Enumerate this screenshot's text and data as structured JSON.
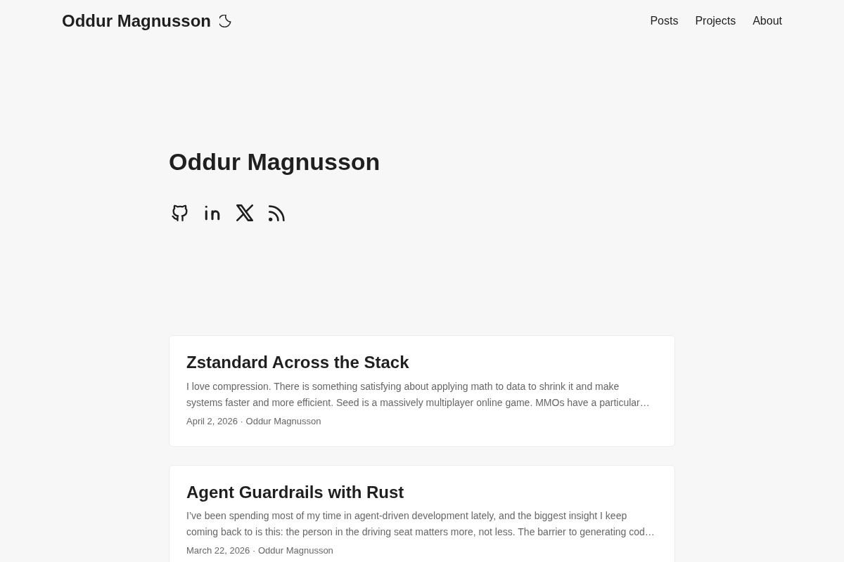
{
  "header": {
    "site_title": "Oddur Magnusson",
    "nav": [
      {
        "label": "Posts"
      },
      {
        "label": "Projects"
      },
      {
        "label": "About"
      }
    ]
  },
  "hero": {
    "title": "Oddur Magnusson",
    "social_links": [
      {
        "kind": "github"
      },
      {
        "kind": "linkedin"
      },
      {
        "kind": "x"
      },
      {
        "kind": "rss"
      }
    ]
  },
  "posts": [
    {
      "title": "Zstandard Across the Stack",
      "summary": "I love compression. There is something satisfying about applying math to data to shrink it and make systems faster and more efficient. Seed is a massively multiplayer online game. MMOs have a particular…",
      "meta": "April 2, 2026 · Oddur Magnusson"
    },
    {
      "title": "Agent Guardrails with Rust",
      "summary": "I’ve been spending most of my time in agent-driven development lately, and the biggest insight I keep coming back to is this: the person in the driving seat matters more, not less. The barrier to generating cod…",
      "meta": "March 22, 2026 · Oddur Magnusson"
    }
  ]
}
